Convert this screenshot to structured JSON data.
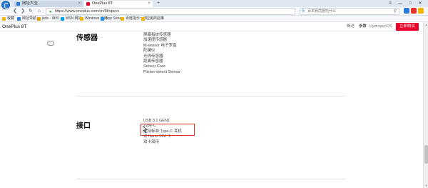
{
  "browser": {
    "tabs": [
      {
        "title": "网址大全",
        "color": "#2d7bd8"
      },
      {
        "title": "OnePlus 8T",
        "color": "#eb0029"
      }
    ],
    "window_controls": [
      "≡",
      "—",
      "□",
      "✕"
    ],
    "address": "https://www.oneplus.com/cn/8t/specs",
    "search_placeholder": "百米赛前要吃什么",
    "colors": {
      "accent": "#2d7bd8",
      "brand_red": "#eb0029",
      "highlight": "#e8312f"
    }
  },
  "bookmarks": [
    {
      "label": "收藏",
      "color": "#f2b705"
    },
    {
      "label": "网址导航",
      "color": "#2d7bd8"
    },
    {
      "label": "jiefe - 百科",
      "color": "#e0a100"
    },
    {
      "label": "MSN 网站",
      "color": "#00a2ed"
    },
    {
      "label": "Windows 应用",
      "color": "#f2b705"
    },
    {
      "label": "App Store",
      "color": "#1c8ef0"
    },
    {
      "label": "百度指示一下",
      "color": "#f2b705"
    },
    {
      "label": "应用商店推",
      "color": "#f2b705"
    }
  ],
  "page": {
    "brand": "OnePlus 8T",
    "nav": {
      "overview": "概述",
      "specs": "参数",
      "os": "HydrogenOS"
    },
    "buy_label": "立即购买"
  },
  "sections": {
    "sensors": {
      "title": "传感器",
      "items": [
        "屏幕指纹传感器",
        "加速度传感器",
        "M-sensor 电子罗盘",
        "陀螺仪",
        "光线传感器",
        "距离传感器",
        "Sensor Core",
        "Flicker-detect Sensor"
      ]
    },
    "ports": {
      "title": "接口",
      "items": [
        "USB 3.1 GEN1",
        "Type-C",
        "支持标准 Type-C 耳机",
        "双 Nano-SIM 卡",
        "双卡双待"
      ]
    }
  }
}
